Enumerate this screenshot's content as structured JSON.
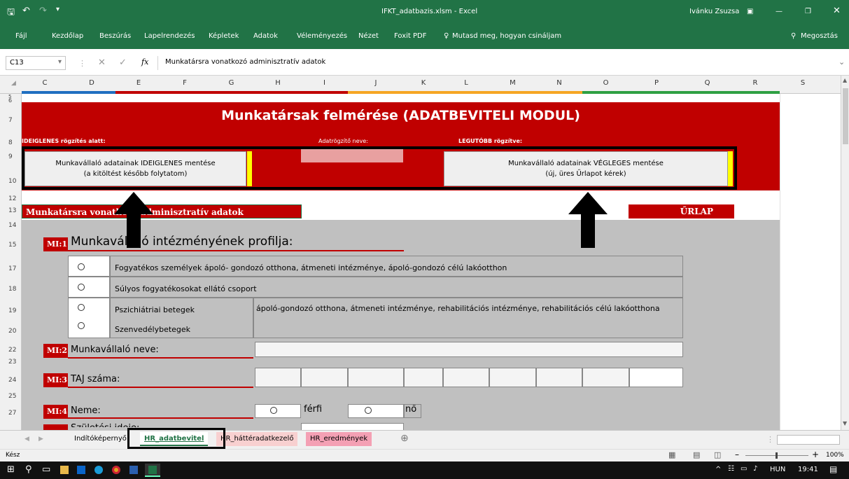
{
  "titlebar": {
    "doc_title": "IFKT_adatbazis.xlsm - Excel",
    "user": "Ivánku Zsuzsa"
  },
  "ribbon": {
    "tabs": [
      "Fájl",
      "Kezdőlap",
      "Beszúrás",
      "Lapelrendezés",
      "Képletek",
      "Adatok",
      "Véleményezés",
      "Nézet",
      "Foxit PDF"
    ],
    "tellme": "Mutasd meg, hogyan csináljam",
    "share": "Megosztás"
  },
  "formula": {
    "namebox": "C13",
    "fx": "fx",
    "content": "Munkatársra vonatkozó adminisztratív adatok"
  },
  "columns": [
    "C",
    "D",
    "E",
    "F",
    "G",
    "H",
    "I",
    "J",
    "K",
    "L",
    "M",
    "N",
    "O",
    "P",
    "Q",
    "R",
    "S"
  ],
  "rows": [
    "5",
    "6",
    "7",
    "8",
    "9",
    "10",
    "12",
    "13",
    "14",
    "15",
    "17",
    "18",
    "19",
    "20",
    "22",
    "23",
    "24",
    "25",
    "27"
  ],
  "sheet": {
    "main_title": "Munkatársak felmérése (ADATBEVITELI MODUL)",
    "row8_left": "IDEIGLENES rögzítés alatt:",
    "row8_mid": "Adatrögzítő neve:",
    "row8_right": "LEGUTÓBB rögzítve:",
    "btn_temp_line1": "Munkavállaló adatainak IDEIGLENES mentése",
    "btn_temp_line2": "(a kitöltést később folytatom)",
    "btn_final_line1": "Munkavállaló adatainak VÉGLEGES mentése",
    "btn_final_line2": "(új, üres Űrlapot kérek)",
    "section_header": "Munkatársra vonatkozó adminisztratív adatok",
    "urlap": "ŰRLAP",
    "mi1_label": "MI:1",
    "mi1_text": "Munkavállaló  intézményének profilja:",
    "mi1_opts": [
      "Fogyatékos személyek ápoló- gondozó otthona, átmeneti intézménye, ápoló-gondozó célú lakóotthon",
      "Súlyos fogyatékosokat ellátó csoport",
      "Pszichiátriai betegek",
      "Szenvedélybetegek"
    ],
    "mi1_shared": "ápoló-gondozó otthona, átmeneti intézménye, rehabilitációs intézménye, rehabilitációs célú lakóotthona",
    "mi2_label": "MI:2",
    "mi2_text": "Munkavállaló neve:",
    "mi3_label": "MI:3",
    "mi3_text": "TAJ száma:",
    "mi4_label": "MI:4",
    "mi4_text": "Neme:",
    "mi4_opt1": "férfi",
    "mi4_opt2": "nő",
    "mi5_partial": "Születési ideje:"
  },
  "sheettabs": [
    "Indítóképernyő",
    "HR_adatbevitel",
    "HR_háttéradatkezelő",
    "HR_eredmények"
  ],
  "status": {
    "ready": "Kész",
    "zoom": "100%"
  },
  "taskbar": {
    "lang": "HUN",
    "time": "19:41"
  },
  "colors": {
    "excel_green": "#217346",
    "form_red": "#c00000",
    "form_gray": "#c0c0c0"
  }
}
